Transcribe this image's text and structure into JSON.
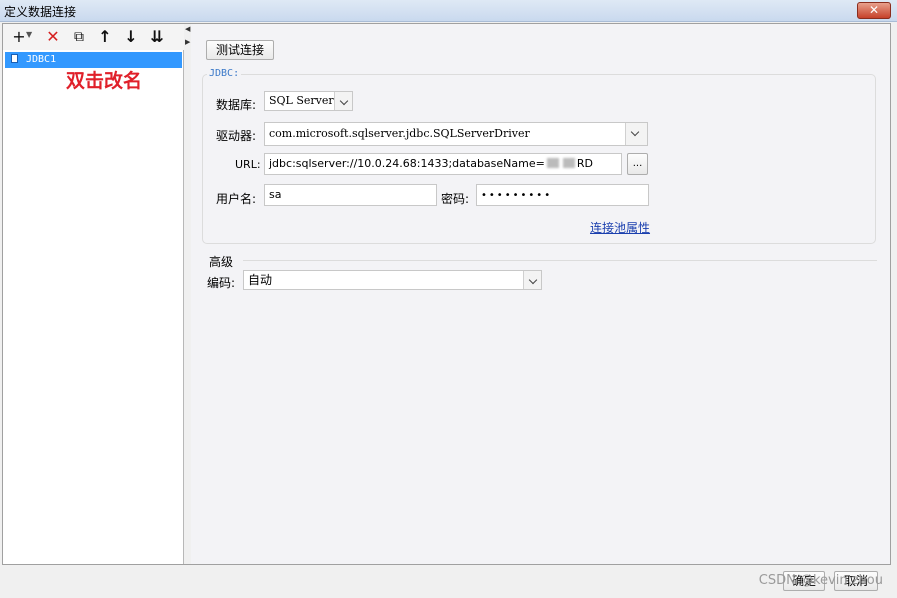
{
  "window": {
    "title": "定义数据连接",
    "close_label": "✕"
  },
  "toolbar": {
    "add": "+",
    "delete": "✕",
    "copy": "⧉",
    "up": "↑",
    "down": "↓",
    "sort": "⇊"
  },
  "connections": [
    {
      "name": "JDBC1"
    }
  ],
  "hint": "双击改名",
  "test_button": "测试连接",
  "jdbc": {
    "legend": "JDBC:",
    "db_label": "数据库:",
    "db_value": "SQL Server",
    "driver_label": "驱动器:",
    "driver_value": "com.microsoft.sqlserver.jdbc.SQLServerDriver",
    "url_label": "URL:",
    "url_value": "jdbc:sqlserver://10.0.24.68:1433;databaseName=",
    "url_suffix": "RD",
    "url_more": "...",
    "user_label": "用户名:",
    "user_value": "sa",
    "pass_label": "密码:",
    "pass_value": "•••••••••",
    "pool_link": "连接池属性"
  },
  "advanced": {
    "title": "高级",
    "encoding_label": "编码:",
    "encoding_value": "自动"
  },
  "footer": {
    "ok": "确定",
    "cancel": "取消",
    "watermark": "CSDN @kevin.zhou"
  }
}
